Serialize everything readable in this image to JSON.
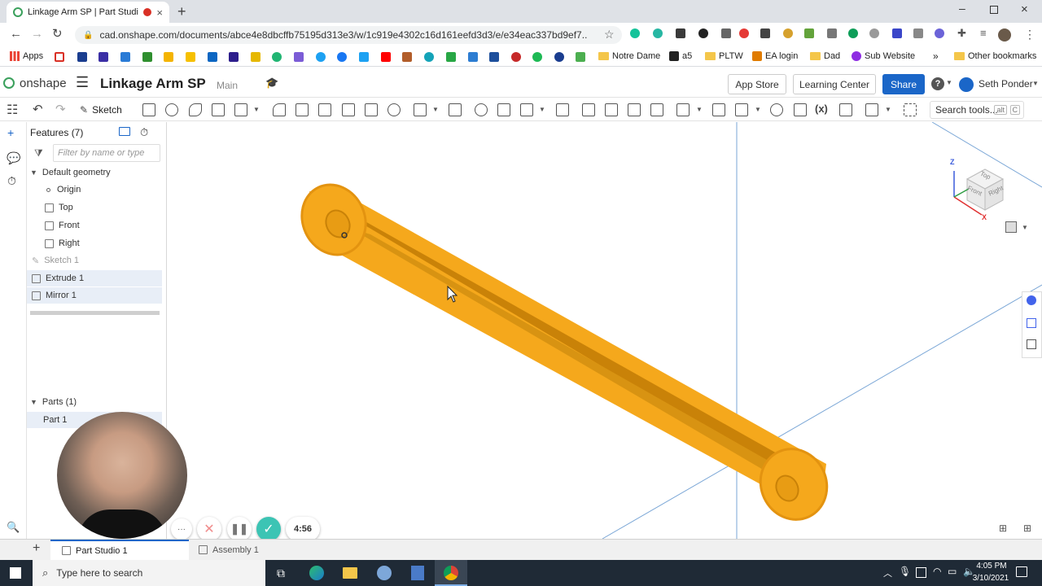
{
  "browser": {
    "tab_title": "Linkage Arm SP | Part Studio",
    "url": "cad.onshape.com/documents/abce4e8dbcffb75195d313e3/w/1c919e4302c16d161eefd3d3/e/e34eac337bd9ef7...",
    "bookmarks": [
      "Apps",
      "Notre Dame",
      "a5",
      "PLTW",
      "EA login",
      "Dad",
      "Sub Website",
      "Other bookmarks"
    ]
  },
  "app": {
    "logo": "onshape",
    "doc_title": "Linkage Arm SP",
    "branch": "Main",
    "app_store": "App Store",
    "learning_center": "Learning Center",
    "share": "Share",
    "help": "?",
    "user": "Seth Ponder"
  },
  "toolbar": {
    "sketch": "Sketch",
    "search_tools": "Search tools...",
    "shortcut_alt": "alt",
    "shortcut_c": "C",
    "variable_label": "(x)"
  },
  "features": {
    "header": "Features (7)",
    "filter_placeholder": "Filter by name or type",
    "group": "Default geometry",
    "items": [
      "Origin",
      "Top",
      "Front",
      "Right",
      "Sketch 1",
      "Extrude 1",
      "Mirror 1"
    ]
  },
  "parts": {
    "header": "Parts (1)",
    "items": [
      "Part 1"
    ]
  },
  "viewcube": {
    "top": "Top",
    "front": "Front",
    "right": "Right",
    "z": "Z",
    "x": "X"
  },
  "recording": {
    "timer": "4:56",
    "more": "···"
  },
  "bottom_tabs": [
    "Part Studio 1",
    "Assembly 1"
  ],
  "taskbar": {
    "search_placeholder": "Type here to search",
    "time": "4:05 PM",
    "date": "3/10/2021"
  },
  "colors": {
    "part": "#f5a81c",
    "part_dark": "#c98208",
    "accent": "#1a66c8"
  }
}
